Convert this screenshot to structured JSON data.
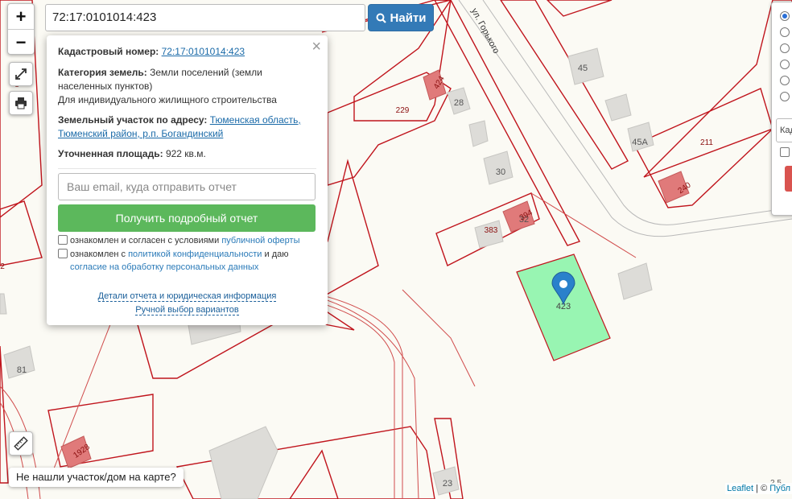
{
  "search": {
    "value": "72:17:0101014:423",
    "button_label": "Найти"
  },
  "zoom": {
    "in_label": "+",
    "out_label": "−"
  },
  "popup": {
    "cadastral_label": "Кадастровый номер:",
    "cadastral_value": "72:17:0101014:423",
    "category_label": "Категория земель:",
    "category_value": "Земли поселений (земли населенных пунктов)",
    "usage": "Для индивидуального жилищного строительства",
    "address_label": "Земельный участок по адресу:",
    "address_value": "Тюменская область, Тюменский район, р.п. Богандинский",
    "area_label": "Уточненная площадь:",
    "area_value": "922 кв.м.",
    "email_placeholder": "Ваш email, куда отправить отчет",
    "report_button": "Получить подробный отчет",
    "offer_text_1": "ознакомлен и согласен с условиями ",
    "offer_link": "публичной оферты",
    "privacy_text_1": "ознакомлен с ",
    "privacy_link": "политикой конфиденциальности",
    "privacy_text_2": " и даю",
    "privacy_link_2": "согласие на обработку персональных данных",
    "details_link": "Детали отчета и юридическая информация",
    "manual_link": "Ручной выбор вариантов",
    "close_symbol": "×"
  },
  "right_panel": {
    "input_text": "Када"
  },
  "not_found_button": "Не нашли участок/дом на карте?",
  "attribution": {
    "leaflet": "Leaflet",
    "sep": " | © ",
    "source": "Публ"
  },
  "scale_hint": "2 5",
  "map": {
    "street_label": "ул. Горького",
    "labels": {
      "l229": "229",
      "l424": "424",
      "l28": "28",
      "l45": "45",
      "l45a": "45А",
      "l211": "211",
      "l240": "240",
      "l30": "30",
      "l383": "383",
      "l394": "394",
      "l32": "32",
      "l423": "423",
      "l81": "81",
      "l1928": "1928",
      "l23": "23",
      "l2": "2",
      "l8": "8"
    },
    "colors": {
      "parcel_line": "#c0141c",
      "selected_fill": "#98f5b2",
      "building": "#ddd",
      "highlight_building": "#e07a7a",
      "marker": "#2a81cb"
    }
  }
}
